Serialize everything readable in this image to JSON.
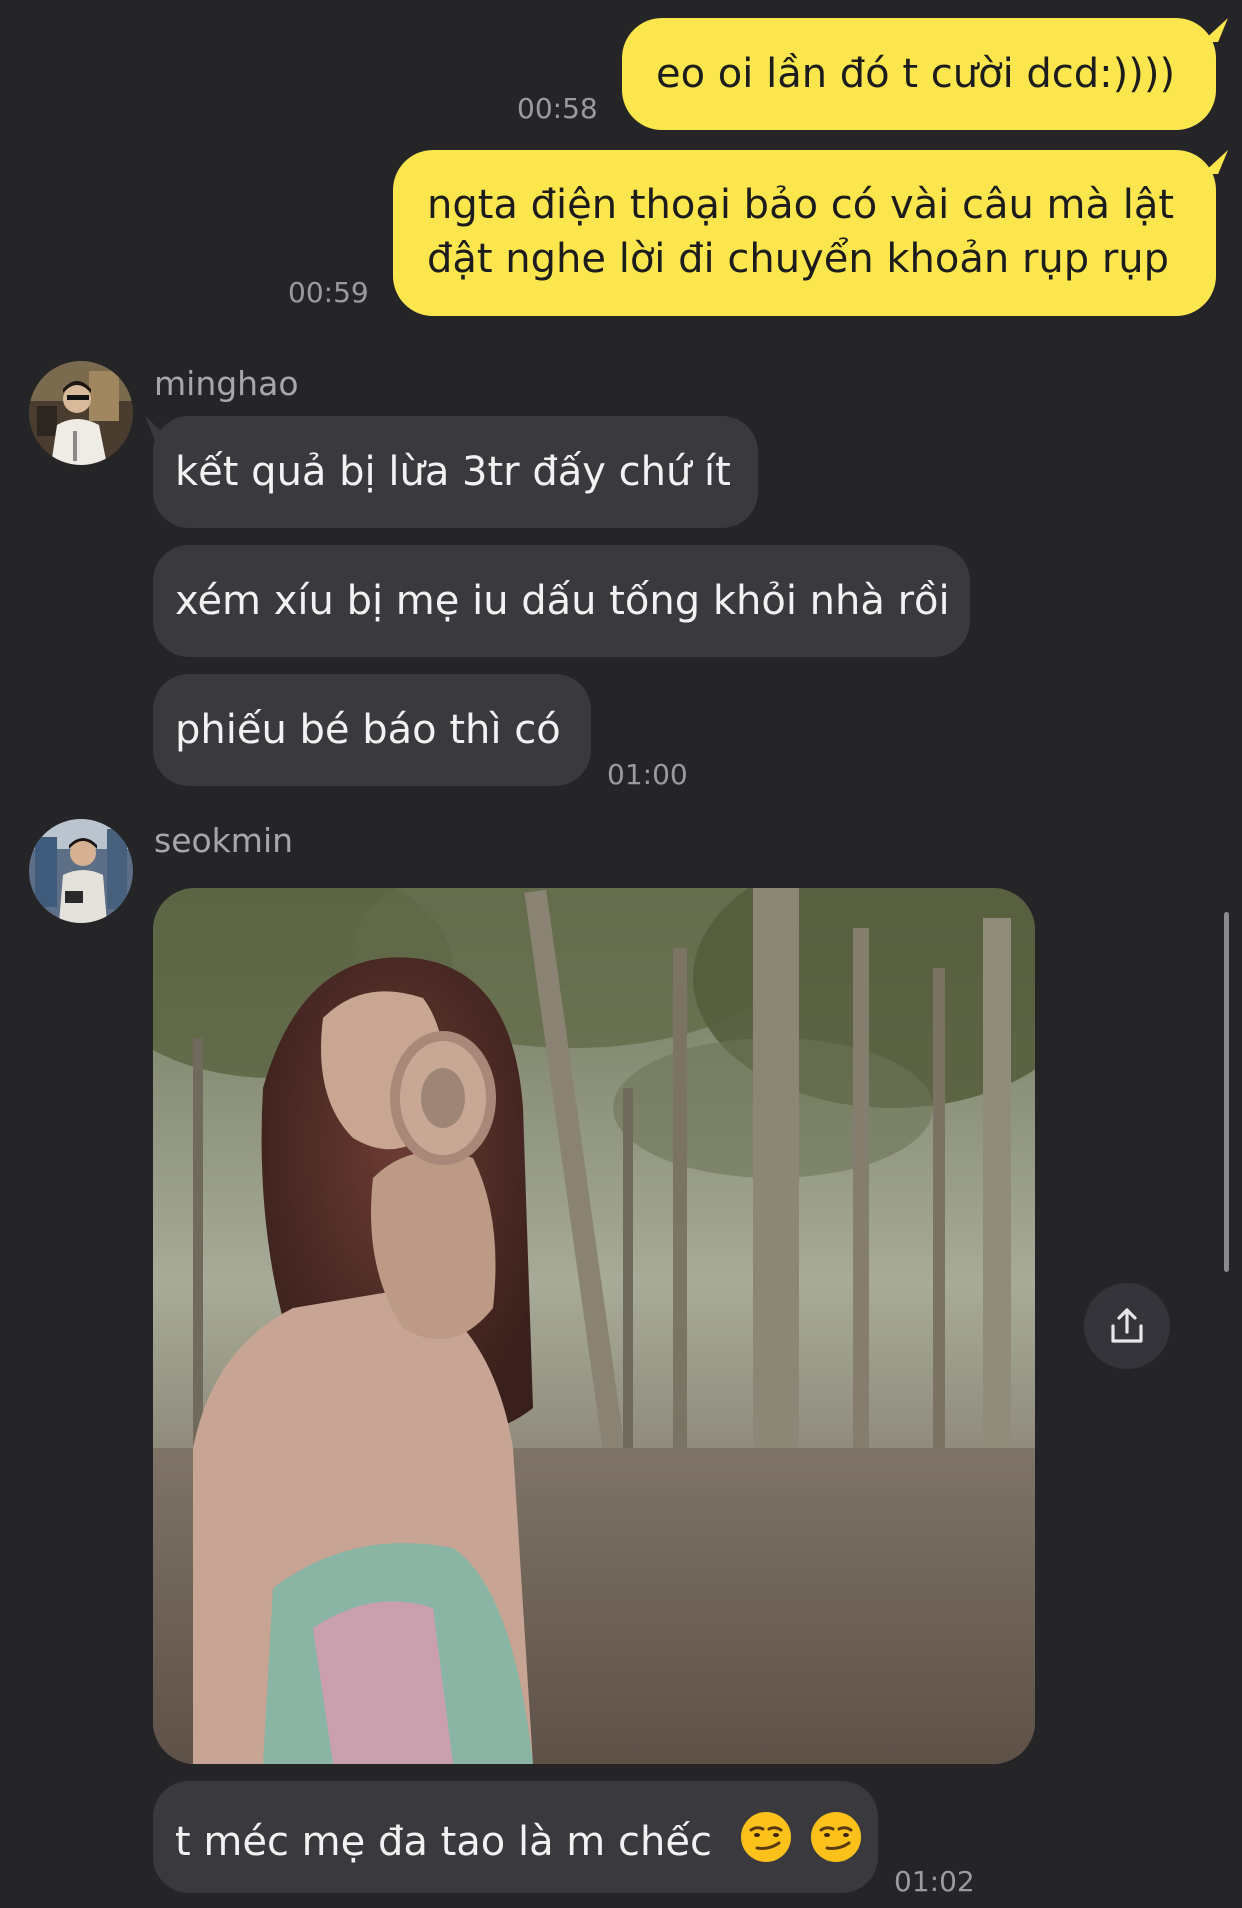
{
  "messages": {
    "m1": {
      "text": "eo oi lần đó t cười dcd:))))",
      "time": "00:58"
    },
    "m2": {
      "line1": "ngta điện thoại bảo có vài câu mà lật",
      "line2": "đật nghe lời đi chuyển khoản rụp rụp",
      "time": "00:59"
    },
    "g1": {
      "sender": "minghao",
      "b1": "kết quả bị lừa 3tr đấy chứ ít",
      "b2": "xém xíu bị mẹ iu dấu tống khỏi nhà rồi",
      "b3": "phiếu bé báo thì có",
      "time": "01:00"
    },
    "g2": {
      "sender": "seokmin",
      "b1": "t méc mẹ đa tao là m chếc",
      "time": "01:02"
    }
  },
  "icons": {
    "share": "share-icon",
    "emoji": "smirking-face-emoji"
  },
  "colors": {
    "background": "#252528",
    "outgoing_bubble": "#fbe64d",
    "incoming_bubble": "#3a3a3e"
  }
}
